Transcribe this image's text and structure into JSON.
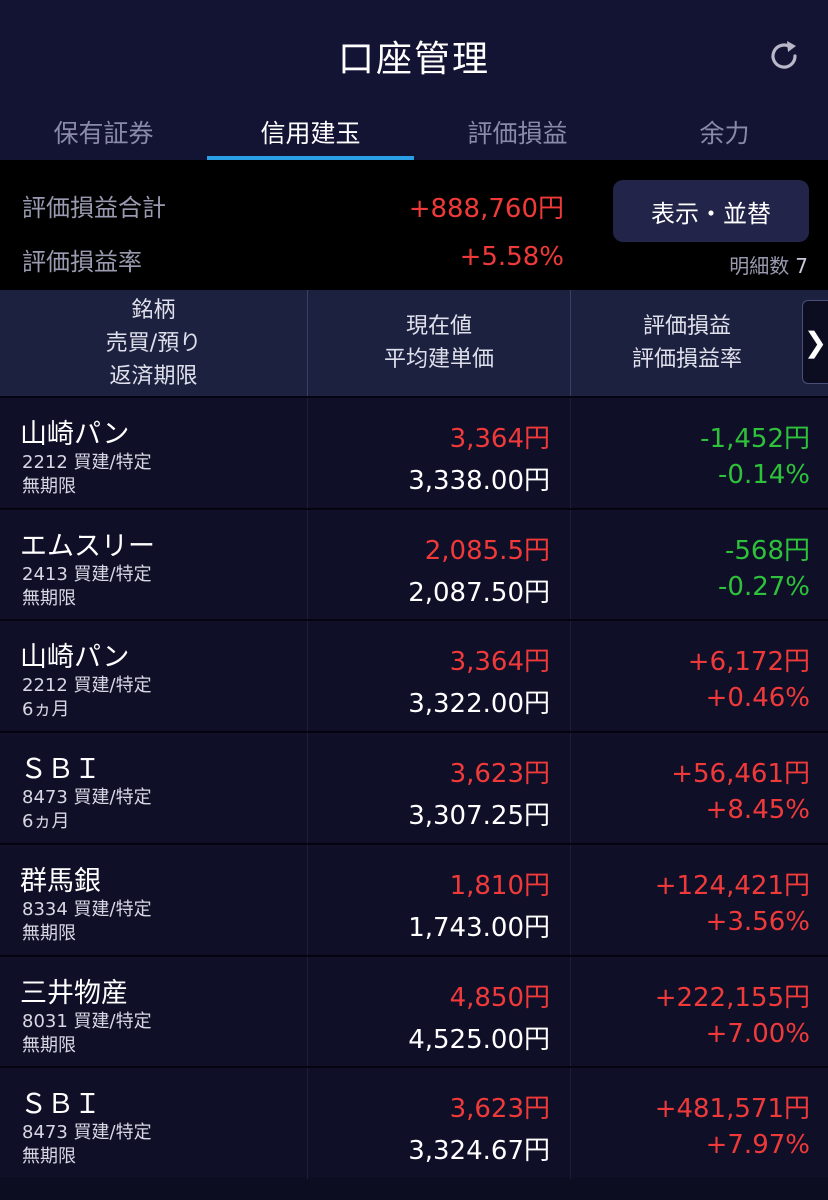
{
  "header": {
    "title": "口座管理",
    "refresh_icon": "refresh-icon"
  },
  "tabs": [
    {
      "label": "保有証券",
      "active": false
    },
    {
      "label": "信用建玉",
      "active": true
    },
    {
      "label": "評価損益",
      "active": false
    },
    {
      "label": "余力",
      "active": false
    }
  ],
  "summary": {
    "total_label": "評価損益合計",
    "total_value": "+888,760円",
    "rate_label": "評価損益率",
    "rate_value": "+5.58%",
    "display_button": "表示・並替",
    "count_label": "明細数",
    "count_value": "7"
  },
  "table_header": {
    "col1": [
      "銘柄",
      "売買/預り",
      "返済期限"
    ],
    "col2": [
      "現在値",
      "平均建単価"
    ],
    "col3": [
      "評価損益",
      "評価損益率"
    ],
    "scroll_icon": "chevron-right-icon"
  },
  "rows": [
    {
      "name": "山崎パン",
      "code_trade": "2212 買建/特定",
      "deadline": "無期限",
      "price": "3,364円",
      "avg": "3,338.00円",
      "pl": "-1,452円",
      "pl_rate": "-0.14%",
      "sign": "neg"
    },
    {
      "name": "エムスリー",
      "code_trade": "2413 買建/特定",
      "deadline": "無期限",
      "price": "2,085.5円",
      "avg": "2,087.50円",
      "pl": "-568円",
      "pl_rate": "-0.27%",
      "sign": "neg"
    },
    {
      "name": "山崎パン",
      "code_trade": "2212 買建/特定",
      "deadline": "6ヵ月",
      "price": "3,364円",
      "avg": "3,322.00円",
      "pl": "+6,172円",
      "pl_rate": "+0.46%",
      "sign": "pos"
    },
    {
      "name": "ＳＢＩ",
      "code_trade": "8473 買建/特定",
      "deadline": "6ヵ月",
      "price": "3,623円",
      "avg": "3,307.25円",
      "pl": "+56,461円",
      "pl_rate": "+8.45%",
      "sign": "pos"
    },
    {
      "name": "群馬銀",
      "code_trade": "8334 買建/特定",
      "deadline": "無期限",
      "price": "1,810円",
      "avg": "1,743.00円",
      "pl": "+124,421円",
      "pl_rate": "+3.56%",
      "sign": "pos"
    },
    {
      "name": "三井物産",
      "code_trade": "8031 買建/特定",
      "deadline": "無期限",
      "price": "4,850円",
      "avg": "4,525.00円",
      "pl": "+222,155円",
      "pl_rate": "+7.00%",
      "sign": "pos"
    },
    {
      "name": "ＳＢＩ",
      "code_trade": "8473 買建/特定",
      "deadline": "無期限",
      "price": "3,623円",
      "avg": "3,324.67円",
      "pl": "+481,571円",
      "pl_rate": "+7.97%",
      "sign": "pos"
    }
  ],
  "colors": {
    "positive": "#f03a3a",
    "negative": "#2ec23a",
    "tab_indicator": "#2a9fe6"
  }
}
